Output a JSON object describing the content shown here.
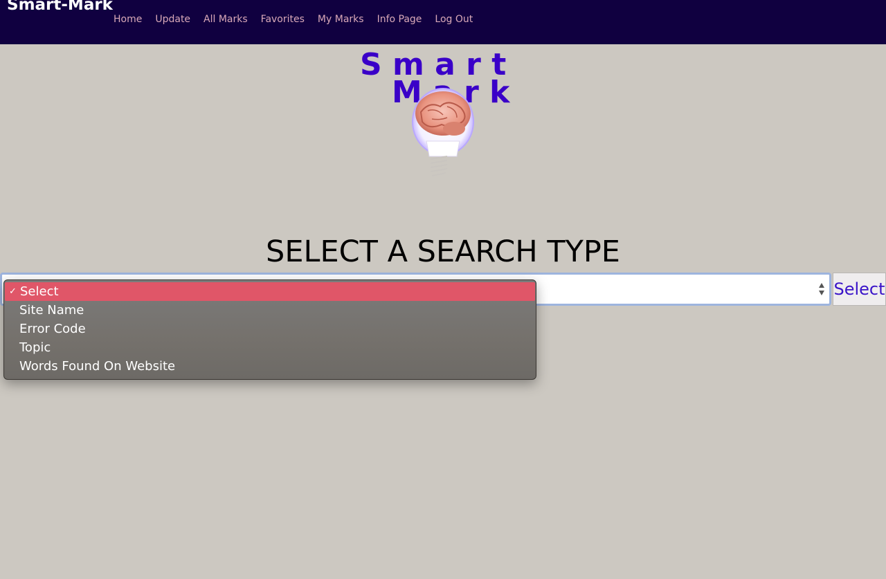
{
  "navbar": {
    "brand": "Smart-Mark",
    "links": [
      "Home",
      "Update",
      "All Marks",
      "Favorites",
      "My Marks",
      "Info Page",
      "Log Out"
    ]
  },
  "logo": {
    "line1": "S m a r t",
    "line2": "M a r k",
    "icon": "lightbulb-brain-icon"
  },
  "main": {
    "title": "SELECT A SEARCH TYPE",
    "select_button": "Select"
  },
  "dropdown": {
    "selected_index": 0,
    "check_mark": "✓",
    "options": [
      "Select",
      "Site Name",
      "Error Code",
      "Topic",
      "Words Found On Website"
    ]
  },
  "colors": {
    "navbar_bg": "#100040",
    "page_bg": "#ccc8c1",
    "nav_link": "#d9a9b8",
    "logo_text": "#3a00c8",
    "selected_option": "#e05668"
  }
}
